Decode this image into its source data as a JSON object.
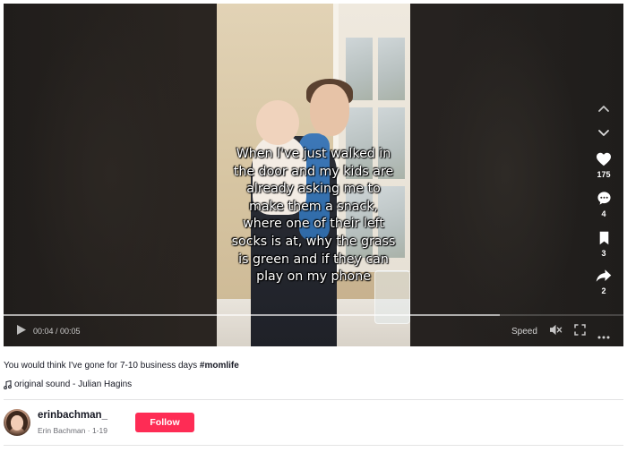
{
  "video": {
    "caption_lines": [
      "When I've just walked in",
      "the door and my kids are",
      "already asking me to",
      "make them a snack,",
      "where one of their left",
      "socks is at, why the grass",
      "is green and if they can",
      "play on my phone"
    ],
    "progress": 0.8
  },
  "actions": {
    "likes": "175",
    "comments": "4",
    "saves": "3",
    "shares": "2"
  },
  "controls": {
    "time": "00:04 / 00:05",
    "speed_label": "Speed"
  },
  "post": {
    "description": "You would think I've gone for 7-10 business days",
    "hashtag": "#momlife",
    "sound": "original sound - Julian Hagins"
  },
  "author": {
    "username": "erinbachman_",
    "subline": "Erin Bachman · 1-19",
    "follow_label": "Follow"
  },
  "colors": {
    "follow_button": "#fe2c55",
    "text": "#161823"
  },
  "icons": [
    "chevron-up-icon",
    "chevron-down-icon",
    "heart-icon",
    "comment-icon",
    "bookmark-icon",
    "share-icon",
    "play-icon",
    "mute-icon",
    "fullscreen-icon",
    "more-icon",
    "music-note-icon"
  ]
}
